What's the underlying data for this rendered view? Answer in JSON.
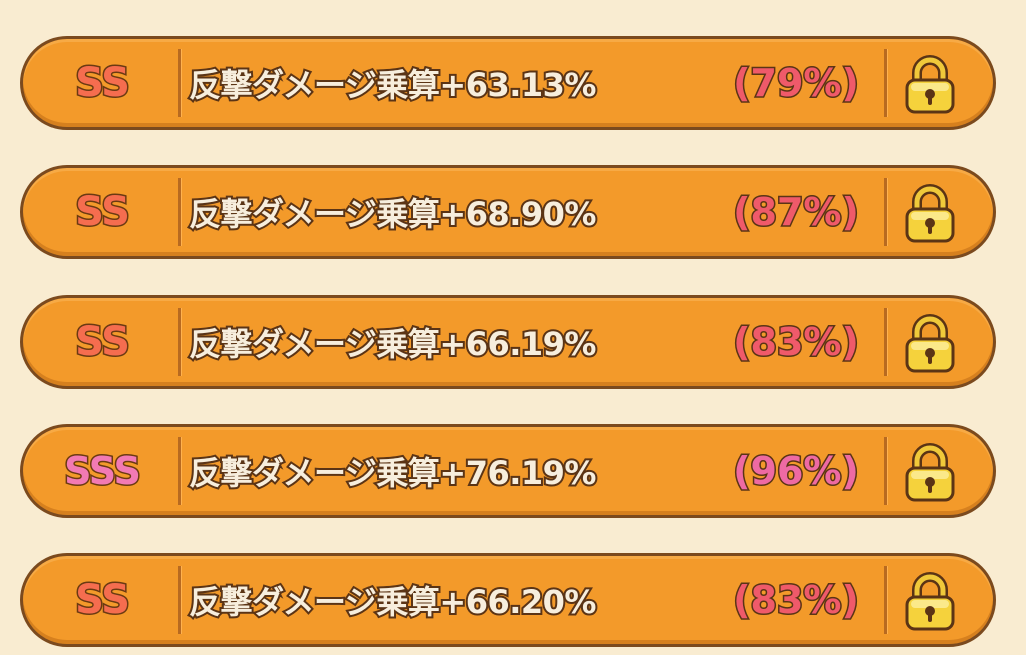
{
  "options": [
    {
      "rank": "SS",
      "tier": "ss",
      "effect": "反撃ダメージ乗算+63.13%",
      "percent": "(79%)",
      "locked": true
    },
    {
      "rank": "SS",
      "tier": "ss",
      "effect": "反撃ダメージ乗算+68.90%",
      "percent": "(87%)",
      "locked": true
    },
    {
      "rank": "SS",
      "tier": "ss",
      "effect": "反撃ダメージ乗算+66.19%",
      "percent": "(83%)",
      "locked": true
    },
    {
      "rank": "SSS",
      "tier": "sss",
      "effect": "反撃ダメージ乗算+76.19%",
      "percent": "(96%)",
      "locked": true
    },
    {
      "rank": "SS",
      "tier": "ss",
      "effect": "反撃ダメージ乗算+66.20%",
      "percent": "(83%)",
      "locked": true
    }
  ],
  "colors": {
    "background": "#f9ecd1",
    "row_fill": "#f39a2a",
    "row_border": "#7b4a1e",
    "rank_ss": "#f56d4f",
    "rank_sss": "#f27ab4",
    "percent": "#ef5a6a",
    "lock_gold": "#f5d23c"
  },
  "icons": {
    "lock": "padlock-icon"
  }
}
